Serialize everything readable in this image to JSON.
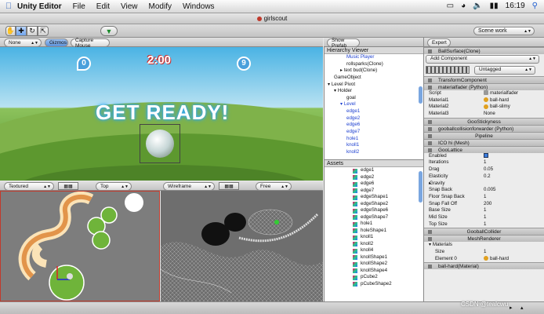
{
  "menubar": {
    "app_name": "Unity Editor",
    "menus": [
      "File",
      "Edit",
      "View",
      "Modify",
      "Windows"
    ],
    "clock": "16:19"
  },
  "window": {
    "title": "girlscout"
  },
  "toolbar": {
    "layout_dropdown": "Scene work"
  },
  "game_view": {
    "aspect_dropdown": "None",
    "gizmos_label": "Gizmos",
    "capture_mouse_label": "Capture Mouse",
    "timer_text": "2:00",
    "ready_text": "GET READY!",
    "badge_left": "0",
    "badge_right": "9"
  },
  "scene_left": {
    "render_mode": "Textured",
    "view": "Top"
  },
  "scene_right": {
    "render_mode": "Wireframe",
    "view": "Free"
  },
  "hierarchy": {
    "show_prefab_label": "Show Prefab",
    "title": "Hierarchy Viewer",
    "items": [
      {
        "label": "Music Player",
        "indent": 3,
        "blue": true
      },
      {
        "label": "rollsparks(Clone)",
        "indent": 3,
        "blue": false
      },
      {
        "label": "text bud(Clone)",
        "indent": 2,
        "blue": false,
        "arrow": "right"
      },
      {
        "label": "GameObject",
        "indent": 1,
        "blue": false
      },
      {
        "label": "Level Pivot",
        "indent": 0,
        "blue": false,
        "arrow": "down"
      },
      {
        "label": "Holder",
        "indent": 1,
        "blue": false,
        "arrow": "down"
      },
      {
        "label": "goal",
        "indent": 3,
        "blue": false
      },
      {
        "label": "Level",
        "indent": 2,
        "blue": true,
        "arrow": "down"
      },
      {
        "label": "edge1",
        "indent": 3,
        "blue": true
      },
      {
        "label": "edge2",
        "indent": 3,
        "blue": true
      },
      {
        "label": "edge6",
        "indent": 3,
        "blue": true
      },
      {
        "label": "edge7",
        "indent": 3,
        "blue": true
      },
      {
        "label": "hole1",
        "indent": 3,
        "blue": true
      },
      {
        "label": "knoll1",
        "indent": 3,
        "blue": true
      },
      {
        "label": "knoll2",
        "indent": 3,
        "blue": true
      }
    ]
  },
  "assets": {
    "title": "Assets",
    "items": [
      "edge1",
      "edge2",
      "edge6",
      "edge7",
      "edgeShape1",
      "edgeShape2",
      "edgeShape6",
      "edgeShape7",
      "hole1",
      "holeShape1",
      "knoll1",
      "knoll2",
      "knoll4",
      "knollShape1",
      "knollShape2",
      "knollShape4",
      "pCube2",
      "pCubeShape2"
    ]
  },
  "inspector": {
    "expert_label": "Expert",
    "object_name": "BallSurface(Clone)",
    "add_component": "Add Component",
    "layer": "Untagged",
    "components": {
      "transform": "TransformComponent",
      "materialfader": "materialfader (Python)",
      "script_label": "Script",
      "script_value": "materialfader",
      "material1_label": "Material1",
      "material1_value": "ball-hard",
      "material2_label": "Material2",
      "material2_value": "ball-slimy",
      "material3_label": "Material3",
      "material3_value": "None",
      "goostickyness": "GooStickyness",
      "forwarder": "gooballcollisionforwarder (Python)",
      "pipeline": "Pipeline",
      "ico_mesh": "ICO hi (Mesh)",
      "goolattice": "GooLattice",
      "lattice_rows": [
        {
          "label": "Enabled",
          "value": ""
        },
        {
          "label": "Iterations",
          "value": "1"
        },
        {
          "label": "Drag",
          "value": "0.05"
        },
        {
          "label": "Elasticity",
          "value": "0.2"
        },
        {
          "label": "Gravity",
          "value": ""
        },
        {
          "label": "Snap Back",
          "value": "0.005"
        },
        {
          "label": "Floor Snap Back",
          "value": "1"
        },
        {
          "label": "Snap Fall Off",
          "value": "200"
        },
        {
          "label": "Base Size",
          "value": "1"
        },
        {
          "label": "Mid Size",
          "value": "1"
        },
        {
          "label": "Top Size",
          "value": "1"
        }
      ],
      "gooball_collider": "GooballCollider",
      "mesh_renderer": "MeshRenderer",
      "materials_label": "Materials",
      "size_label": "Size",
      "size_value": "1",
      "element0_label": "Element 0",
      "element0_value": "ball-hard",
      "ballhard_material": "ball-hard(Material)"
    }
  },
  "watermark": "CSDN @tealcwu"
}
